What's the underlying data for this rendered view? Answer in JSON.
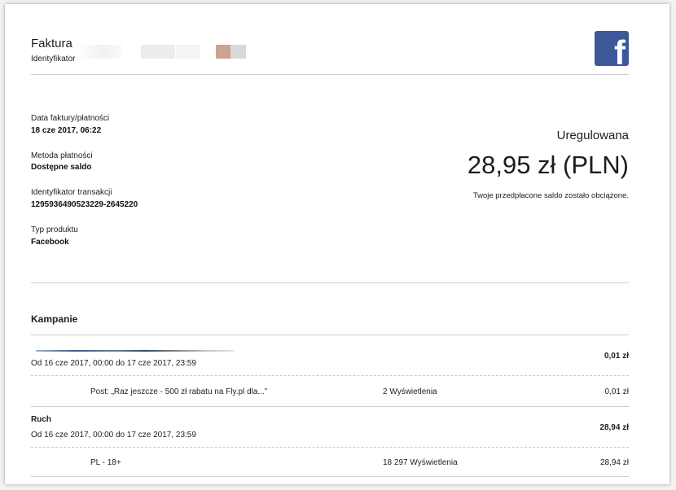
{
  "header": {
    "title": "Faktura",
    "identifier_label": "Identyfikator"
  },
  "brand": {
    "icon": "facebook-icon",
    "glyph": "f",
    "color": "#3b5998"
  },
  "details": [
    {
      "label": "Data faktury/płatności",
      "value": "18 cze 2017, 06:22"
    },
    {
      "label": "Metoda płatności",
      "value": "Dostępne saldo"
    },
    {
      "label": "Identyfikator transakcji",
      "value": "1295936490523229-2645220"
    },
    {
      "label": "Typ produktu",
      "value": "Facebook"
    }
  ],
  "summary": {
    "status": "Uregulowana",
    "amount": "28,95 zł (PLN)",
    "note": "Twoje przedpłacone saldo zostało obciążone."
  },
  "campaigns": {
    "heading": "Kampanie",
    "groups": [
      {
        "name": "",
        "period": "Od 16 cze 2017, 00:00 do 17 cze 2017, 23:59",
        "total": "0,01 zł",
        "items": [
          {
            "name": "Post: „Raz jeszcze - 500 zł rabatu na Fly.pl dla...”",
            "metric": "2 Wyświetlenia",
            "amount": "0,01 zł"
          }
        ]
      },
      {
        "name": "Ruch",
        "period": "Od 16 cze 2017, 00:00 do 17 cze 2017, 23:59",
        "total": "28,94 zł",
        "items": [
          {
            "name": "PL - 18+",
            "metric": "18 297 Wyświetlenia",
            "amount": "28,94 zł"
          }
        ]
      }
    ]
  }
}
